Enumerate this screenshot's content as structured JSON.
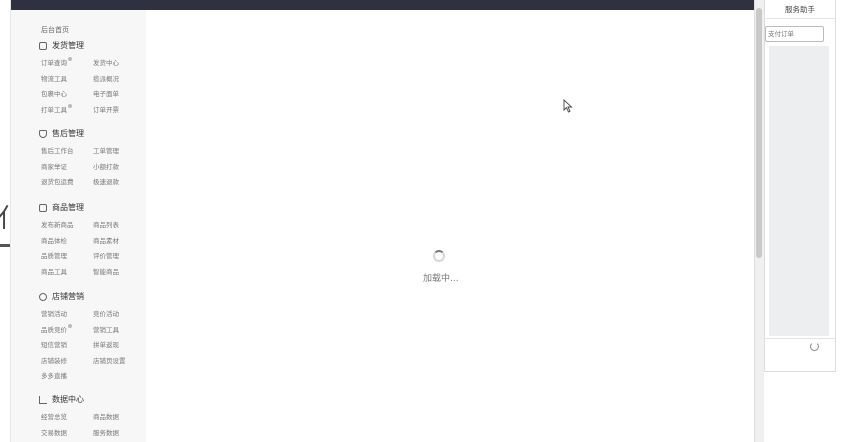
{
  "background_window": {
    "partial_text": "亻"
  },
  "sidebar": {
    "home": "后台首页",
    "sections": [
      {
        "title": "发货管理",
        "icon": "box-icon",
        "items": [
          [
            "订单查询",
            "发货中心"
          ],
          [
            "物流工具",
            "揽派概况"
          ],
          [
            "包裹中心",
            "电子面单"
          ],
          [
            "打单工具",
            "订单开票"
          ]
        ],
        "badges": [
          [
            true,
            false
          ],
          [
            false,
            false
          ],
          [
            false,
            false
          ],
          [
            true,
            false
          ]
        ]
      },
      {
        "title": "售后管理",
        "icon": "shield-icon",
        "items": [
          [
            "售后工作台",
            "工单管理"
          ],
          [
            "商家举证",
            "小额打款"
          ],
          [
            "退货包运费",
            "极速退款"
          ]
        ],
        "badges": [
          [
            false,
            false
          ],
          [
            false,
            false
          ],
          [
            false,
            false
          ]
        ]
      },
      {
        "title": "商品管理",
        "icon": "goods-icon",
        "items": [
          [
            "发布新商品",
            "商品列表"
          ],
          [
            "商品体检",
            "商品素材"
          ],
          [
            "品质管理",
            "评价管理"
          ],
          [
            "商品工具",
            "智能商品"
          ]
        ],
        "badges": [
          [
            false,
            false
          ],
          [
            false,
            false
          ],
          [
            false,
            false
          ],
          [
            false,
            false
          ]
        ]
      },
      {
        "title": "店铺营销",
        "icon": "clock-icon",
        "items": [
          [
            "营销活动",
            "竞价活动"
          ],
          [
            "品质竞价",
            "营销工具"
          ],
          [
            "短信营销",
            "拼单返现"
          ],
          [
            "店铺装修",
            "店铺页设置"
          ],
          [
            "多多直播",
            ""
          ]
        ],
        "badges": [
          [
            false,
            false
          ],
          [
            true,
            false
          ],
          [
            false,
            false
          ],
          [
            false,
            false
          ],
          [
            false,
            false
          ]
        ]
      },
      {
        "title": "数据中心",
        "icon": "chart-icon",
        "items": [
          [
            "经营总览",
            "商品数据"
          ],
          [
            "交易数据",
            "服务数据"
          ]
        ],
        "badges": [
          [
            false,
            false
          ],
          [
            false,
            false
          ]
        ]
      }
    ]
  },
  "main": {
    "loading_text": "加载中..."
  },
  "assistant": {
    "title": "服务助手",
    "input_value": "支付订单"
  }
}
